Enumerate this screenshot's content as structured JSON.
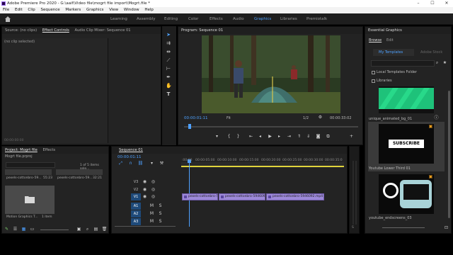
{
  "window": {
    "title": "Adobe Premiere Pro 2020 - G:\\aaif\\Video file\\mogrt file import\\Mogrt.file *"
  },
  "menu": [
    "File",
    "Edit",
    "Clip",
    "Sequence",
    "Markers",
    "Graphics",
    "View",
    "Window",
    "Help"
  ],
  "workspaces": [
    "Learning",
    "Assembly",
    "Editing",
    "Color",
    "Effects",
    "Audio",
    "Graphics",
    "Libraries",
    "Premiotalk"
  ],
  "workspaces_active": "Graphics",
  "source_panel": {
    "tabs": [
      "Source: (no clips)",
      "Effect Controls",
      "Audio Clip Mixer: Sequence 01"
    ],
    "active": "Effect Controls",
    "body": "(no clip selected)",
    "timecode": "00:00:00:00"
  },
  "program_monitor": {
    "title": "Program: Sequence 01",
    "timecode": "00:00:01:11",
    "fit": "Fit",
    "fraction": "1/2",
    "duration": "00:00:33:02"
  },
  "project_panel": {
    "tabs": [
      "Project: Mogrt file",
      "Effects"
    ],
    "file": "Mogrt file.prproj",
    "count": "1 of 5 items sele...",
    "items": [
      {
        "name": "pexels-cottonbro-59...",
        "duration": "55:23"
      },
      {
        "name": "pexels-cottonbro-59...",
        "duration": "32:21"
      },
      {
        "name": "Motion Graphics T...",
        "duration": "1 item"
      }
    ]
  },
  "timeline": {
    "title": "Sequence 01",
    "timecode": "00:00:01:11",
    "ruler": [
      ":00:00",
      "00:00:05:00",
      "00:00:10:00",
      "00:00:15:00",
      "00:00:20:00",
      "00:00:25:00",
      "00:00:30:00",
      "00:00:35:0"
    ],
    "video_tracks": [
      "V3",
      "V2",
      "V1"
    ],
    "audio_tracks": [
      "A1",
      "A2",
      "A3"
    ],
    "clips": [
      "pexels-cottonbro-5946...",
      "pexels-cottonbro-5946091.mp4",
      "pexels-cottonbro-5946092.mp4"
    ],
    "track_letters": {
      "mute": "M",
      "solo": "S"
    }
  },
  "essential_graphics": {
    "title": "Essential Graphics",
    "tabs": [
      "Browse",
      "Edit"
    ],
    "active": "Browse",
    "my_templates": "My Templates",
    "adobe_stock": "Adobe Stock",
    "checks": [
      "Local Templates Folder",
      "Libraries"
    ],
    "templates": [
      {
        "name": "unique_animated_bg_01"
      },
      {
        "name": "Youtube Lower Third 01",
        "thumb_text": "SUBSCRIBE"
      },
      {
        "name": "youtube_endscreens_03"
      }
    ]
  },
  "colors": {
    "accent": "#2d8ceb",
    "playhead": "#4ea1ff",
    "clip": "#9c88d8",
    "track_selected": "#1e4a7a"
  }
}
